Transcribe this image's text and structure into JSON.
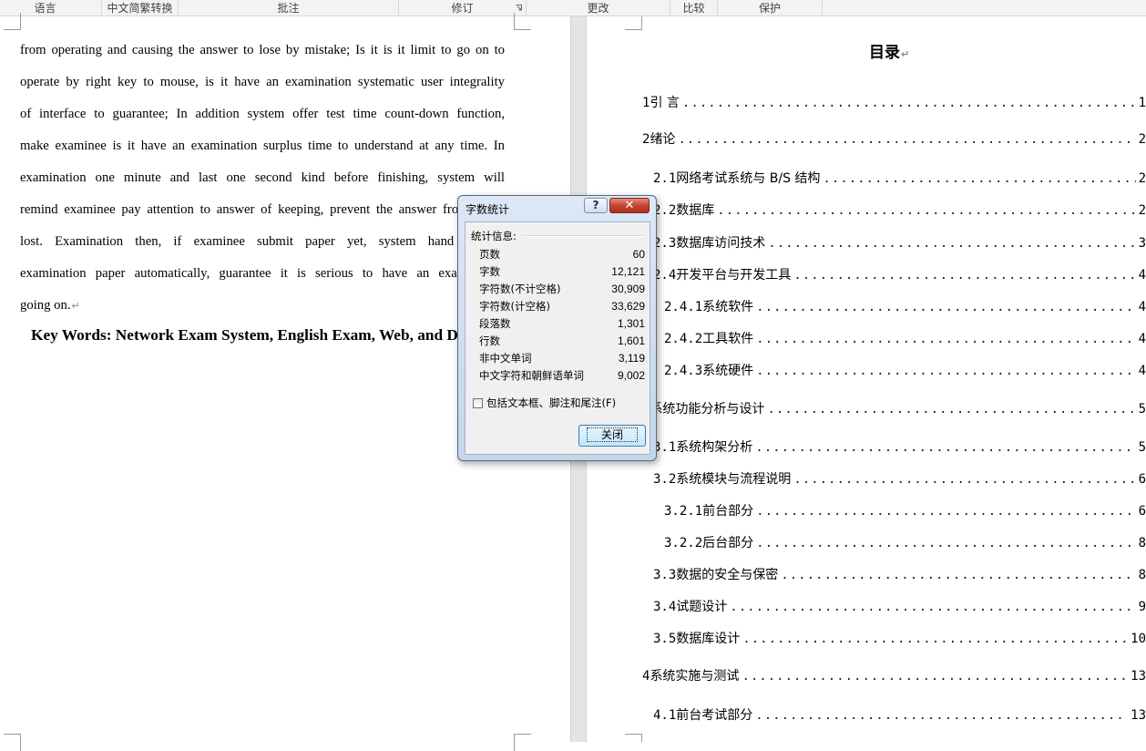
{
  "ribbon": {
    "groups": [
      {
        "label": "语言",
        "name": "language"
      },
      {
        "label": "中文简繁转换",
        "name": "chinese-conversion"
      },
      {
        "label": "批注",
        "name": "comments"
      },
      {
        "label": "修订",
        "name": "tracking"
      },
      {
        "label": "更改",
        "name": "changes"
      },
      {
        "label": "比较",
        "name": "compare"
      },
      {
        "label": "保护",
        "name": "protect"
      }
    ]
  },
  "left_page": {
    "lines": [
      "from operating and causing the answer to lose by mistake; Is it is it limit to go on to",
      "operate by right key to mouse, is it have an examination systematic user integrality",
      "of interface to guarantee; In addition system offer test time count-down function,",
      "make examinee is it have an examination surplus time to understand at any time. In",
      "examination one minute and last one second kind before finishing, system will",
      "remind examinee pay attention to answer of keeping, prevent the answer from being",
      "lost. Examination then, if examinee submit paper yet, system hand in the",
      "examination paper automatically, guarantee it is serious to have an examination",
      "going on."
    ],
    "keywords": "Key Words: Network Exam System, English Exam, Web, and Database",
    "para_mark": "↵"
  },
  "right_page": {
    "title": "目录",
    "toc": [
      {
        "num": "1",
        "label": "引 言",
        "page": "1",
        "indent": 0
      },
      {
        "num": "2",
        "label": "绪论",
        "page": "2",
        "indent": 0
      },
      {
        "num": "2.1",
        "label": "网络考试系统与 B/S 结构",
        "page": "2",
        "indent": 1
      },
      {
        "num": "2.2",
        "label": "数据库",
        "page": "2",
        "indent": 1
      },
      {
        "num": "2.3",
        "label": "数据库访问技术",
        "page": "3",
        "indent": 1
      },
      {
        "num": "2.4",
        "label": "开发平台与开发工具",
        "page": "4",
        "indent": 1
      },
      {
        "num": "2.4.1",
        "label": "系统软件",
        "page": "4",
        "indent": 2
      },
      {
        "num": "2.4.2",
        "label": "工具软件",
        "page": "4",
        "indent": 2
      },
      {
        "num": "2.4.3",
        "label": "系统硬件",
        "page": "4",
        "indent": 2
      },
      {
        "num": "3",
        "label": "系统功能分析与设计",
        "page": "5",
        "indent": 0
      },
      {
        "num": "3.1",
        "label": "系统构架分析",
        "page": "5",
        "indent": 1
      },
      {
        "num": "3.2",
        "label": "系统模块与流程说明",
        "page": "6",
        "indent": 1
      },
      {
        "num": "3.2.1",
        "label": "前台部分",
        "page": "6",
        "indent": 2
      },
      {
        "num": "3.2.2",
        "label": "后台部分",
        "page": "8",
        "indent": 2
      },
      {
        "num": "3.3",
        "label": "数据的安全与保密",
        "page": "8",
        "indent": 1
      },
      {
        "num": "3.4",
        "label": "试题设计",
        "page": "9",
        "indent": 1
      },
      {
        "num": "3.5",
        "label": "数据库设计",
        "page": "10",
        "indent": 1
      },
      {
        "num": "4",
        "label": "系统实施与测试",
        "page": "13",
        "indent": 0
      },
      {
        "num": "4.1",
        "label": "前台考试部分",
        "page": "13",
        "indent": 1
      }
    ]
  },
  "dialog": {
    "title": "字数统计",
    "help": "?",
    "close_x": "✕",
    "legend": "统计信息:",
    "stats": [
      {
        "label": "页数",
        "value": "60"
      },
      {
        "label": "字数",
        "value": "12,121"
      },
      {
        "label": "字符数(不计空格)",
        "value": "30,909"
      },
      {
        "label": "字符数(计空格)",
        "value": "33,629"
      },
      {
        "label": "段落数",
        "value": "1,301"
      },
      {
        "label": "行数",
        "value": "1,601"
      },
      {
        "label": "非中文单词",
        "value": "3,119"
      },
      {
        "label": "中文字符和朝鲜语单词",
        "value": "9,002"
      }
    ],
    "checkbox_label": "包括文本框、脚注和尾注(F)",
    "checkbox_checked": false,
    "close_button": "关闭"
  }
}
